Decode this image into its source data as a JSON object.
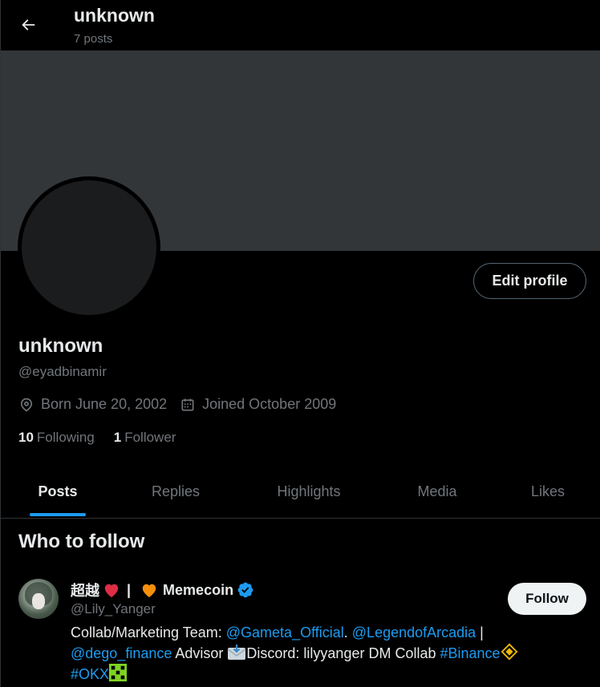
{
  "header": {
    "title": "unknown",
    "posts_count": "7 posts"
  },
  "profile": {
    "name": "unknown",
    "handle": "@eyadbinamir",
    "edit_label": "Edit profile",
    "born": "Born June 20, 2002",
    "joined": "Joined October 2009",
    "following_count": "10",
    "following_label": "Following",
    "followers_count": "1",
    "followers_label": "Follower"
  },
  "tabs": [
    {
      "label": "Posts",
      "active": true
    },
    {
      "label": "Replies",
      "active": false
    },
    {
      "label": "Highlights",
      "active": false
    },
    {
      "label": "Media",
      "active": false
    },
    {
      "label": "Likes",
      "active": false
    }
  ],
  "who_to_follow": {
    "title": "Who to follow",
    "suggestion": {
      "name_part1": "超越",
      "separator": "|",
      "name_part2": "Memecoin",
      "handle": "@Lily_Yanger",
      "follow_label": "Follow",
      "bio": {
        "t1": "Collab/Marketing Team: ",
        "m1": "@Gameta_Official",
        "t2": ". ",
        "m2": "@LegendofArcadia",
        "t3": " |",
        "m3": "@dego_finance",
        "t4": " Advisor ",
        "t5": "Discord: lilyyanger DM Collab ",
        "h1": "#Binance",
        "h2": "#OKX"
      }
    }
  },
  "colors": {
    "accent": "#1d9bf0",
    "banner": "#333639",
    "muted_text": "#71767b"
  },
  "icons": [
    "back-arrow-icon",
    "location-icon",
    "calendar-icon",
    "verified-badge-icon",
    "heart-emoji-icon",
    "orange-heart-emoji-icon",
    "envelope-emoji-icon",
    "binance-logo-icon",
    "okx-logo-icon"
  ]
}
